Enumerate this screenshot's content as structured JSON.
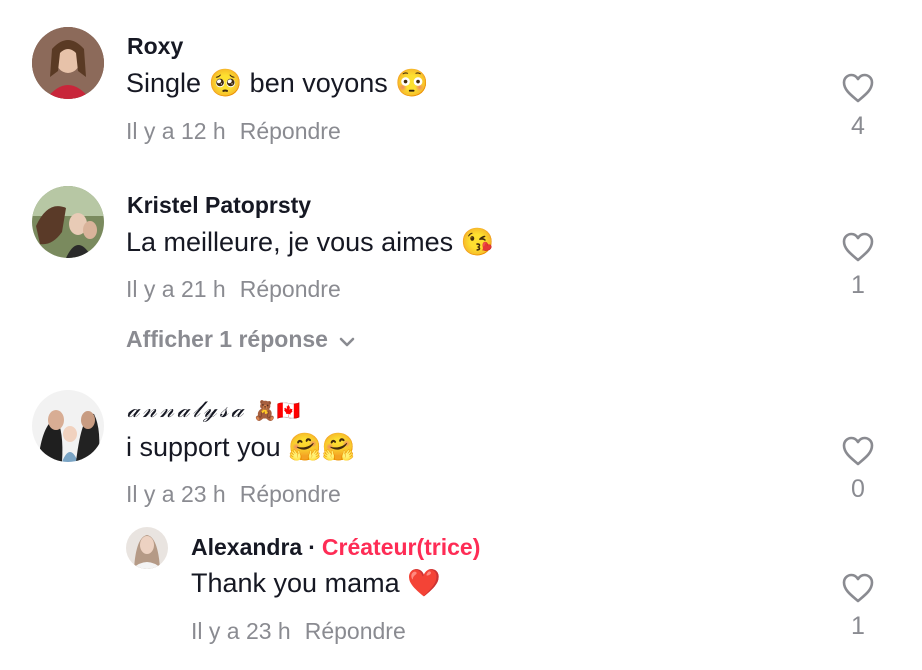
{
  "comments": [
    {
      "username": "Roxy",
      "text": "Single 🥺 ben voyons 😳",
      "time": "Il y a 12 h",
      "reply_label": "Répondre",
      "likes": "4"
    },
    {
      "username": "Kristel Patoprsty",
      "text": "La meilleure, je vous aimes 😘",
      "time": "Il y a 21 h",
      "reply_label": "Répondre",
      "likes": "1",
      "view_replies": "Afficher 1 réponse"
    },
    {
      "username": "𝒶𝓃𝓃𝒶𝓁𝓎𝓈𝒶",
      "username_emoji": "🧸🇨🇦",
      "text": "i support you 🤗🤗",
      "time": "Il y a 23 h",
      "reply_label": "Répondre",
      "likes": "0",
      "reply": {
        "username": "Alexandra",
        "separator": "·",
        "badge": "Créateur(trice)",
        "text": "Thank you mama ❤️",
        "time": "Il y a 23 h",
        "reply_label": "Répondre",
        "likes": "1"
      }
    }
  ],
  "icons": {
    "like": "heart-outline-icon",
    "expand": "chevron-down-icon"
  },
  "colors": {
    "primary_text": "#161823",
    "secondary_text": "#8a8b91",
    "creator_badge": "#fe2c55"
  }
}
